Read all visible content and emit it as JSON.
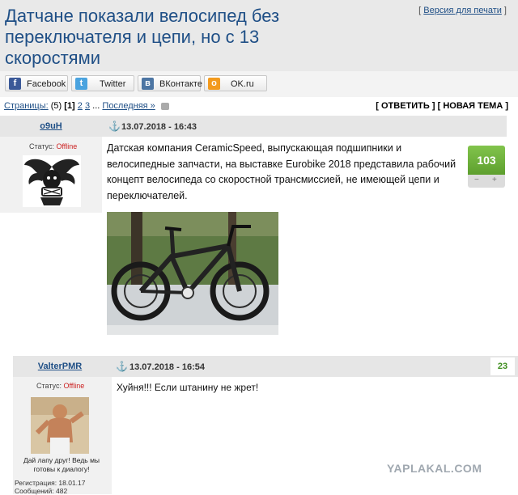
{
  "topic": {
    "title": "Датчане показали велосипед без переключателя и цепи, но с 13 скоростями",
    "print_link": "Версия для печати"
  },
  "share": [
    {
      "label": "Facebook",
      "icon": "facebook-icon",
      "color": "#3b5998"
    },
    {
      "label": "Twitter",
      "icon": "twitter-icon",
      "color": "#4aa3df"
    },
    {
      "label": "ВКонтакте",
      "icon": "vk-icon",
      "color": "#4c75a3"
    },
    {
      "label": "OK.ru",
      "icon": "ok-icon",
      "color": "#f39a1d"
    }
  ],
  "pagination": {
    "label": "Страницы:",
    "count": "(5)",
    "current": "[1]",
    "p2": "2",
    "p3": "3",
    "ellipsis": "...",
    "last": "Последняя »",
    "reply": "[ ОТВЕТИТЬ ]",
    "new_topic": "[ НОВАЯ ТЕМА ]"
  },
  "posts": [
    {
      "author": "o9uH",
      "date": "13.07.2018 - 16:43",
      "status_label": "Статус:",
      "status": "Offline",
      "text": "Датская компания CeramicSpeed, выпускающая подшипники и велосипедные запчасти, на выставке Eurobike 2018 представила рабочий концепт велосипеда со скоростной трансмиссией, не имеющей цепи и переключателей.",
      "rating": "103",
      "vote_minus": "−",
      "vote_plus": "+"
    },
    {
      "author": "ValterPMR",
      "date": "13.07.2018 - 16:54",
      "status_label": "Статус:",
      "status": "Offline",
      "text": "Хуйня!!! Если штанину не жрет!",
      "rating": "23",
      "signature": "Дай лапу друг! Ведь мы готовы к диалогу!",
      "registration": "Регистрация: 18.01.17",
      "messages": "Сообщений: 482"
    }
  ],
  "watermark": "YAPLAKAL.COM"
}
